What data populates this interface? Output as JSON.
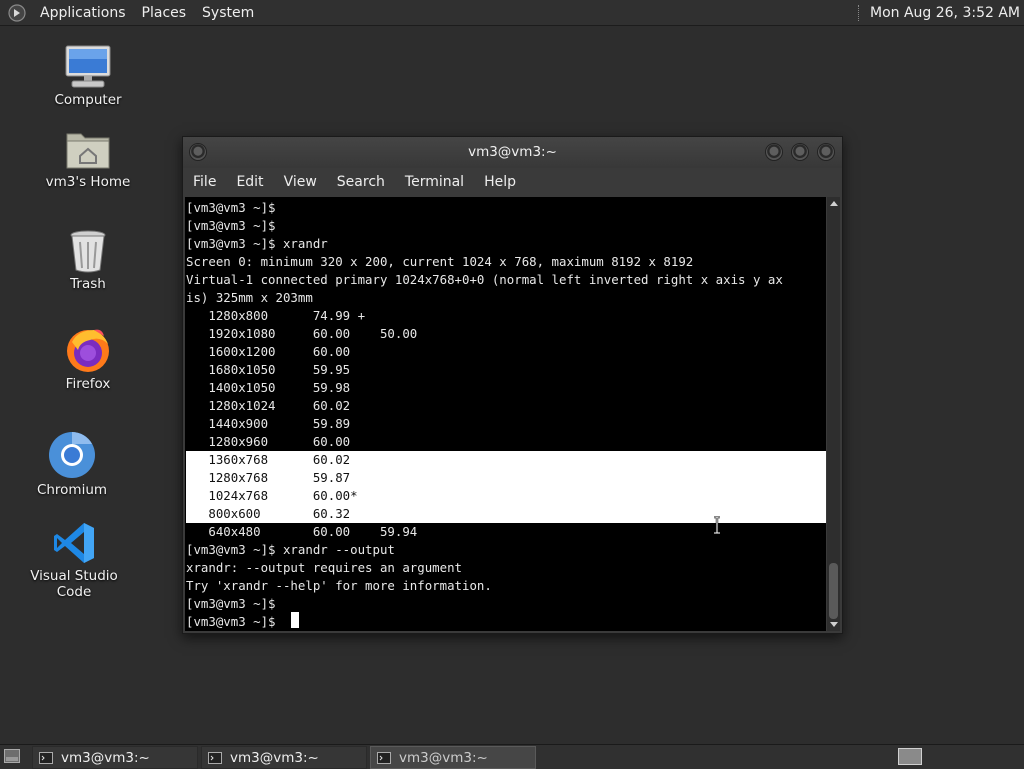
{
  "top_panel": {
    "menus": [
      "Applications",
      "Places",
      "System"
    ],
    "clock": "Mon Aug 26,  3:52 AM"
  },
  "desktop_icons": [
    {
      "label": "Computer",
      "icon": "computer-icon"
    },
    {
      "label": "vm3's Home",
      "icon": "home-folder-icon"
    },
    {
      "label": "Trash",
      "icon": "trash-icon"
    },
    {
      "label": "Firefox",
      "icon": "firefox-icon"
    },
    {
      "label": "Chromium",
      "icon": "chromium-icon"
    },
    {
      "label": "Visual Studio Code",
      "icon": "vscode-icon"
    }
  ],
  "window": {
    "title": "vm3@vm3:~",
    "menu": [
      "File",
      "Edit",
      "View",
      "Search",
      "Terminal",
      "Help"
    ]
  },
  "terminal": {
    "lines": [
      "[vm3@vm3 ~]$",
      "[vm3@vm3 ~]$",
      "[vm3@vm3 ~]$ xrandr",
      "Screen 0: minimum 320 x 200, current 1024 x 768, maximum 8192 x 8192",
      "Virtual-1 connected primary 1024x768+0+0 (normal left inverted right x axis y ax",
      "is) 325mm x 203mm",
      "   1280x800      74.99 +",
      "   1920x1080     60.00    50.00",
      "   1600x1200     60.00",
      "   1680x1050     59.95",
      "   1400x1050     59.98",
      "   1280x1024     60.02",
      "   1440x900      59.89",
      "   1280x960      60.00",
      "   1360x768      60.02",
      "   1280x768      59.87",
      "   1024x768      60.00*",
      "   800x600       60.32",
      "   640x480       60.00    59.94",
      "[vm3@vm3 ~]$ xrandr --output",
      "xrandr: --output requires an argument",
      "Try 'xrandr --help' for more information.",
      "[vm3@vm3 ~]$",
      "[vm3@vm3 ~]$ "
    ],
    "selected_lines": [
      14,
      15,
      16,
      17
    ]
  },
  "taskbar": {
    "tasks": [
      {
        "label": "vm3@vm3:~",
        "active": false
      },
      {
        "label": "vm3@vm3:~",
        "active": false
      },
      {
        "label": "vm3@vm3:~",
        "active": true
      }
    ]
  },
  "colors": {
    "desktop": "#2d2d2d",
    "panel": "#303030",
    "terminal_bg": "#000000",
    "terminal_fg": "#e8e8e8",
    "selection": "#ffffff",
    "vscode_blue": "#1e88e5",
    "chromium_blue": "#4a90d9",
    "firefox_orange": "#ff7a1a"
  }
}
